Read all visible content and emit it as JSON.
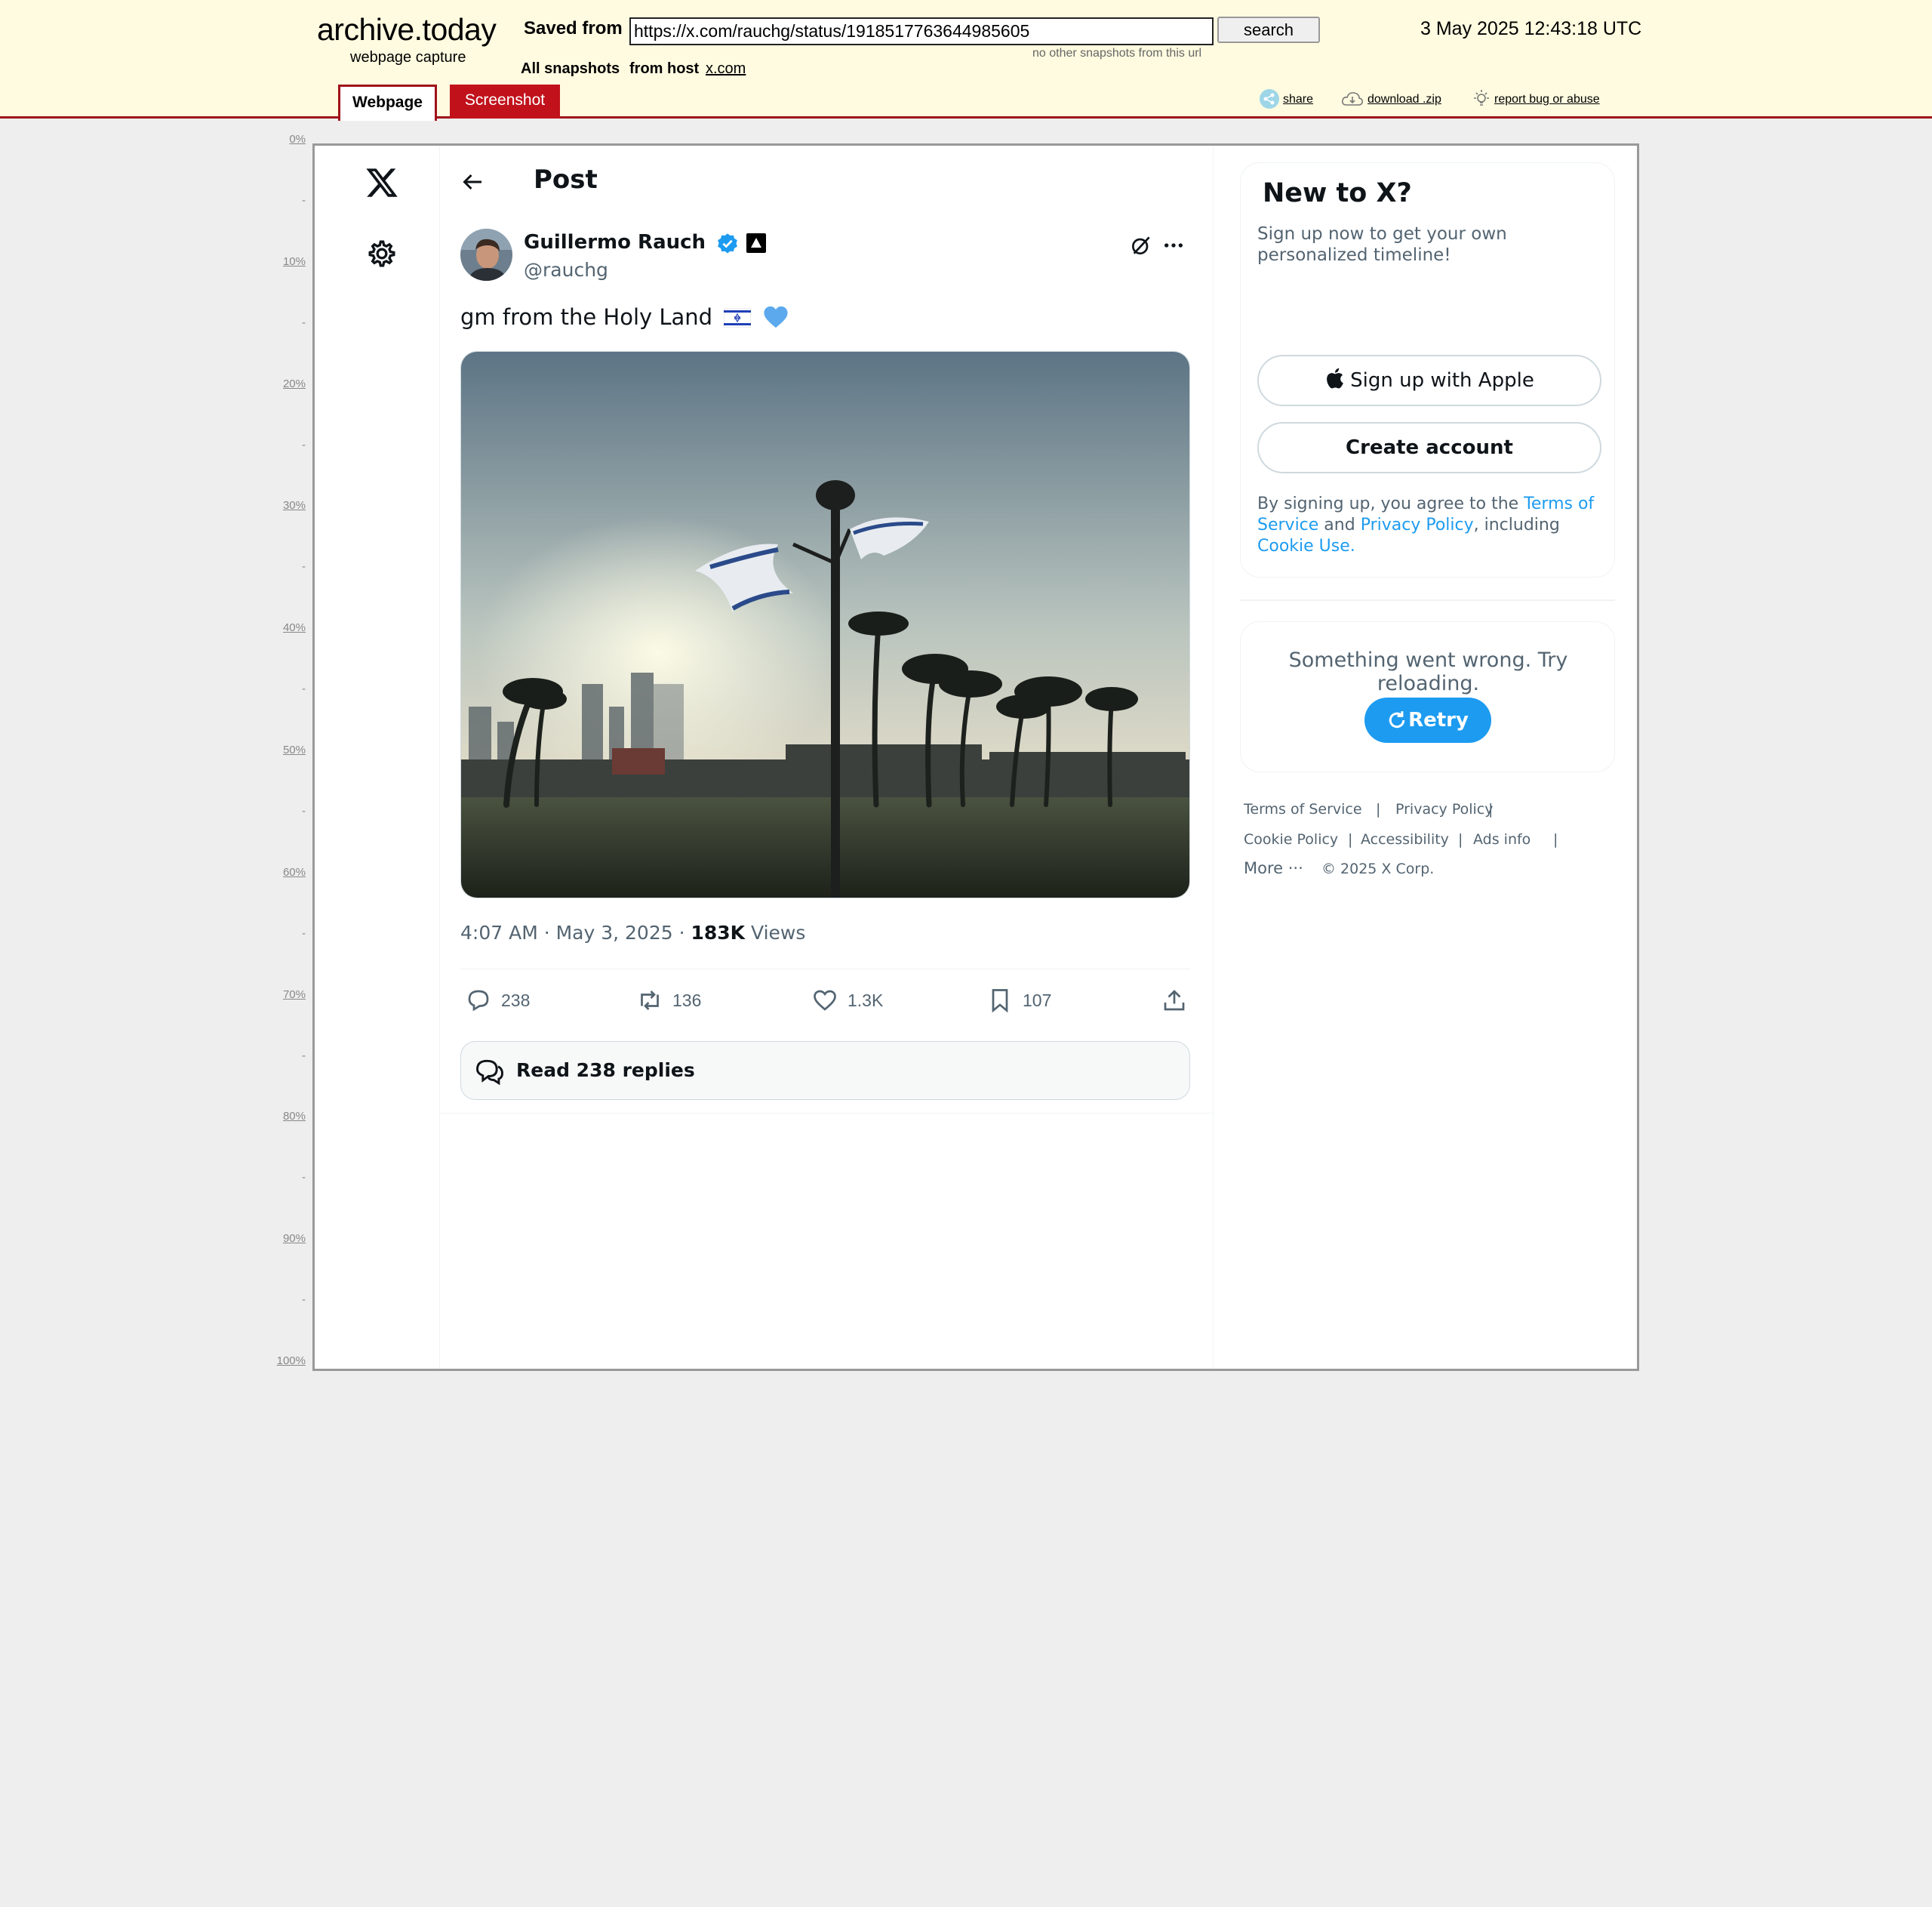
{
  "archive": {
    "logo": "archive.today",
    "logo_sub": "webpage capture",
    "saved_from_label": "Saved from",
    "url_value": "https://x.com/rauchg/status/1918517763644985605",
    "search_label": "search",
    "no_other_snapshots": "no other snapshots from this url",
    "capture_date": "3 May 2025 12:43:18 UTC",
    "all_snapshots_label": "All snapshots",
    "from_host_label": "from host",
    "host": "x.com",
    "tabs": [
      {
        "label": "Webpage"
      },
      {
        "label": "Screenshot"
      }
    ],
    "utils": [
      {
        "label": "share",
        "icon": "share-icon"
      },
      {
        "label": "download .zip",
        "icon": "cloud-download-icon"
      },
      {
        "label": "report bug or abuse",
        "icon": "bulb-icon"
      }
    ],
    "ruler": [
      "0%",
      "-",
      "10%",
      "-",
      "20%",
      "-",
      "30%",
      "-",
      "40%",
      "-",
      "50%",
      "-",
      "60%",
      "-",
      "70%",
      "-",
      "80%",
      "-",
      "90%",
      "-",
      "100%"
    ]
  },
  "post": {
    "title": "Post",
    "author": {
      "name": "Guillermo Rauch",
      "handle": "@rauchg"
    },
    "text": "gm from the Holy Land",
    "time": "4:07 AM · May 3, 2025 · ",
    "views_count": "183K",
    "views_label": "Views",
    "actions": {
      "replies": "238",
      "reposts": "136",
      "likes": "1.3K",
      "bookmarks": "107"
    },
    "read_replies": "Read 238 replies"
  },
  "sidebar": {
    "new_title": "New to X?",
    "new_sub": "Sign up now to get your own personalized timeline!",
    "apple_btn": "Sign up with Apple",
    "create_btn": "Create account",
    "legal": {
      "pre": "By signing up, you agree to the ",
      "tos": "Terms of Service",
      "and": " and ",
      "pp": "Privacy Policy",
      "incl": ", including ",
      "cookie": "Cookie Use",
      "end": "."
    },
    "error_text": "Something went wrong. Try reloading.",
    "retry": "Retry",
    "footer": {
      "terms": "Terms of Service",
      "privacy": "Privacy Policy",
      "cookie": "Cookie Policy",
      "accessibility": "Accessibility",
      "ads": "Ads info",
      "more": "More ···",
      "copyright": "© 2025 X Corp."
    }
  },
  "colors": {
    "archive_red": "#a0121a",
    "archive_bg": "#fffbe0",
    "x_blue": "#1d9bf0",
    "text_gray": "#536471"
  }
}
